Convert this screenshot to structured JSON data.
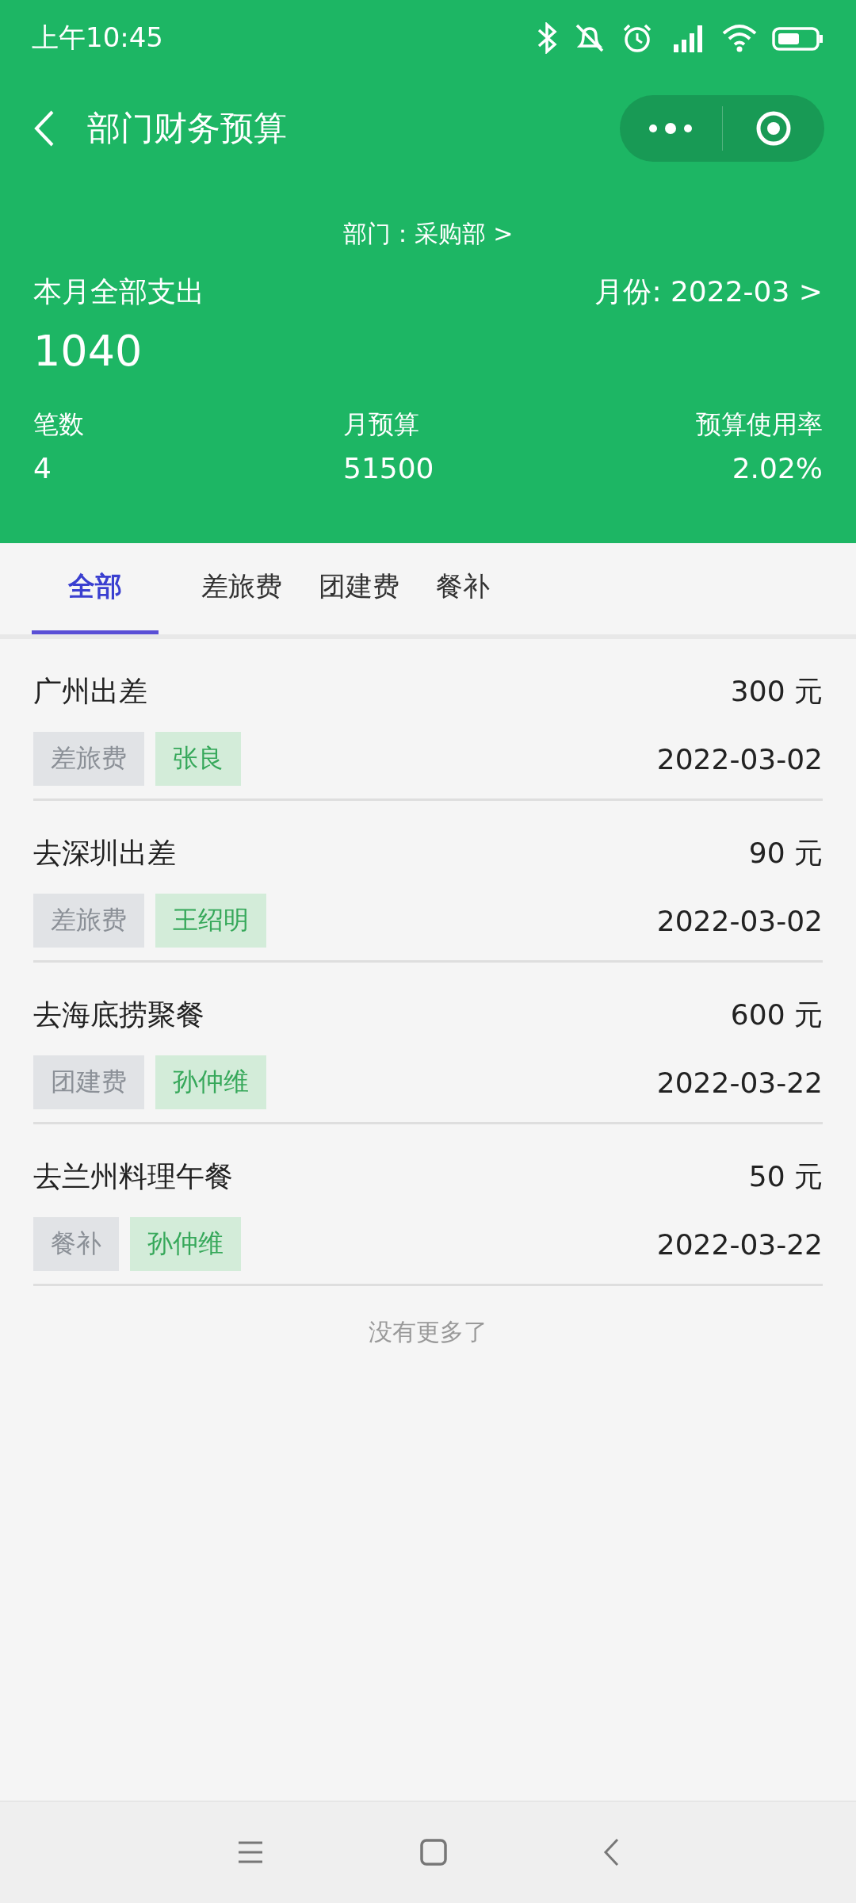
{
  "status_bar": {
    "time": "上午10:45"
  },
  "header": {
    "title": "部门财务预算"
  },
  "department": {
    "label": "部门：采购部 >"
  },
  "summary": {
    "label": "本月全部支出",
    "month": "月份: 2022-03 >",
    "total": "1040"
  },
  "stats": [
    {
      "label": "笔数",
      "value": "4"
    },
    {
      "label": "月预算",
      "value": "51500"
    },
    {
      "label": "预算使用率",
      "value": "2.02%"
    }
  ],
  "tabs": [
    {
      "label": "全部",
      "selected": true
    },
    {
      "label": "差旅费",
      "selected": false
    },
    {
      "label": "团建费",
      "selected": false
    },
    {
      "label": "餐补",
      "selected": false
    }
  ],
  "records": [
    {
      "title": "广州出差",
      "amount": "300 元",
      "category": "差旅费",
      "person": "张良",
      "date": "2022-03-02"
    },
    {
      "title": "去深圳出差",
      "amount": "90 元",
      "category": "差旅费",
      "person": "王绍明",
      "date": "2022-03-02"
    },
    {
      "title": "去海底捞聚餐",
      "amount": "600 元",
      "category": "团建费",
      "person": "孙仲维",
      "date": "2022-03-22"
    },
    {
      "title": "去兰州料理午餐",
      "amount": "50 元",
      "category": "餐补",
      "person": "孙仲维",
      "date": "2022-03-22"
    }
  ],
  "footer": "没有更多了"
}
